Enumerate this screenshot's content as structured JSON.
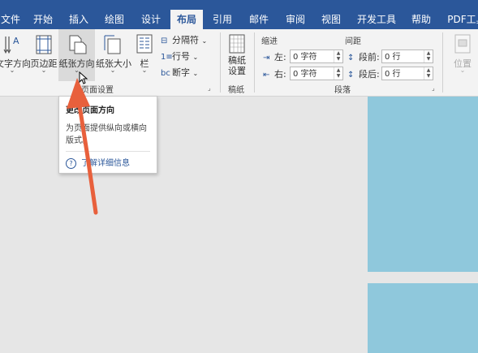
{
  "titlebar": {
    "left_text": "...",
    "right_text": "..."
  },
  "tabs": [
    {
      "label": "文件"
    },
    {
      "label": "开始"
    },
    {
      "label": "插入"
    },
    {
      "label": "绘图"
    },
    {
      "label": "设计"
    },
    {
      "label": "布局"
    },
    {
      "label": "引用"
    },
    {
      "label": "邮件"
    },
    {
      "label": "审阅"
    },
    {
      "label": "视图"
    },
    {
      "label": "开发工具"
    },
    {
      "label": "帮助"
    },
    {
      "label": "PDF工具"
    }
  ],
  "ribbon": {
    "page_setup": {
      "text_direction": "文字方向",
      "margins": "页边距",
      "orientation": "纸张方向",
      "size": "纸张大小",
      "columns": "栏",
      "breaks": "分隔符",
      "line_numbers": "行号",
      "hyphenation": "断字",
      "group_label": "页面设置"
    },
    "manuscript": {
      "button": "稿纸\n设置",
      "group_label": "稿纸"
    },
    "indent": {
      "title": "缩进",
      "left_label": "左:",
      "left_value": "0 字符",
      "right_label": "右:",
      "right_value": "0 字符"
    },
    "spacing": {
      "title": "间距",
      "before_label": "段前:",
      "before_value": "0 行",
      "after_label": "段后:",
      "after_value": "0 行"
    },
    "paragraph_group_label": "段落",
    "position": "位置"
  },
  "tooltip": {
    "title": "更改页面方向",
    "description": "为页面提供纵向或横向版式。",
    "help_link": "了解详细信息"
  },
  "colors": {
    "accent": "#2b579a",
    "page": "#8fc8dc",
    "annotation_arrow": "#e8603c"
  }
}
